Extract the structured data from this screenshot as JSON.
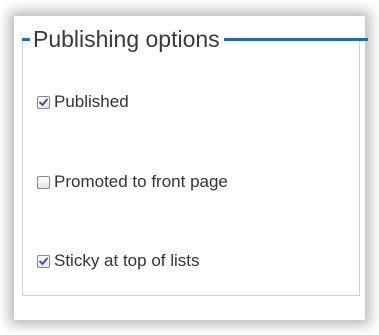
{
  "fieldset": {
    "legend": "Publishing options",
    "accent_color": "#1f6fb7"
  },
  "options": [
    {
      "label": "Published",
      "checked": true
    },
    {
      "label": "Promoted to front page",
      "checked": false
    },
    {
      "label": "Sticky at top of lists",
      "checked": true
    }
  ]
}
